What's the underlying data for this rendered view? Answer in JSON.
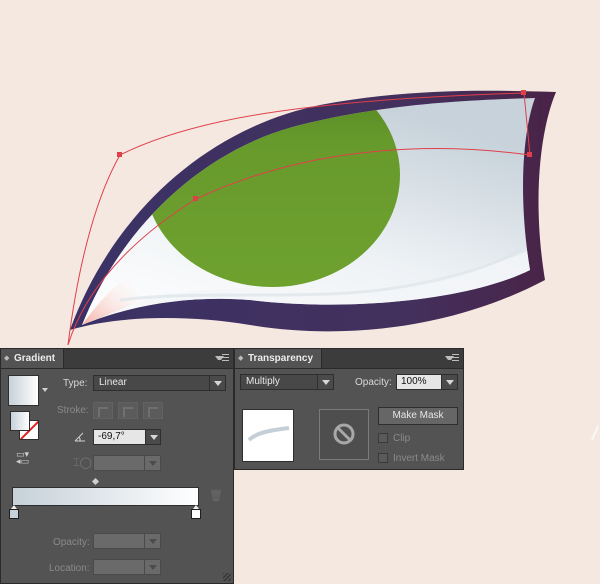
{
  "colors": {
    "background": "#f5e8e0",
    "iris": "#6a9b2c",
    "eyelid": "#4a2f5a",
    "path_handle": "#e0404a",
    "panel": "#535353",
    "panel_header": "#3c3c3c"
  },
  "gradient_panel": {
    "tab_label": "Gradient",
    "type_label": "Type:",
    "type_value": "Linear",
    "stroke_label": "Stroke:",
    "angle_value": "-69,7°",
    "opacity_label": "Opacity:",
    "location_label": "Location:",
    "icons": [
      "gradient-swatch-icon",
      "angle-icon",
      "aspect-ratio-icon",
      "reverse-gradient-icon",
      "trash-icon"
    ]
  },
  "transparency_panel": {
    "tab_label": "Transparency",
    "blend_mode": "Multiply",
    "opacity_label": "Opacity:",
    "opacity_value": "100%",
    "make_mask_label": "Make Mask",
    "clip_label": "Clip",
    "invert_mask_label": "Invert Mask",
    "icons": [
      "object-thumbnail",
      "no-mask-icon"
    ]
  }
}
